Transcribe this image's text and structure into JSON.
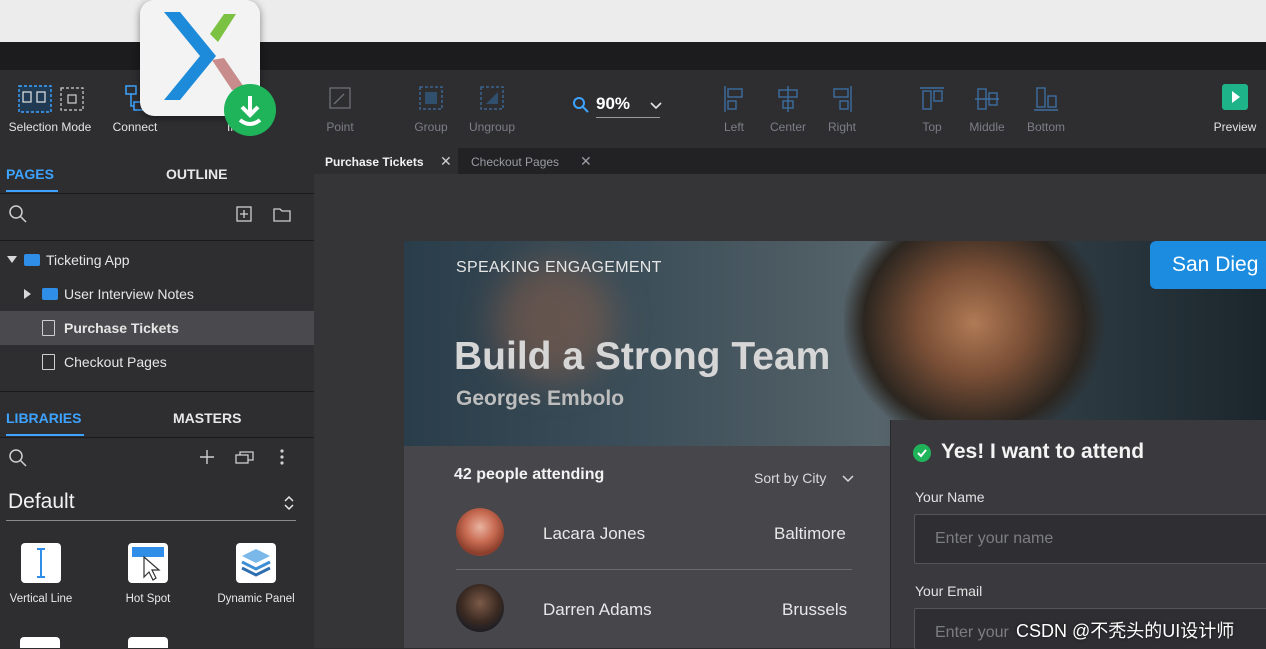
{
  "toolbar": {
    "selection_mode": "Selection Mode",
    "connect": "Connect",
    "insert_partial": "In",
    "point": "Point",
    "group": "Group",
    "ungroup": "Ungroup",
    "zoom": "90%",
    "left": "Left",
    "center": "Center",
    "right": "Right",
    "top": "Top",
    "middle": "Middle",
    "bottom": "Bottom",
    "preview": "Preview"
  },
  "panels": {
    "pages_tab": "PAGES",
    "outline_tab": "OUTLINE",
    "libraries_tab": "LIBRARIES",
    "masters_tab": "MASTERS"
  },
  "tree": {
    "root": "Ticketing App",
    "items": [
      {
        "label": "User Interview Notes"
      },
      {
        "label": "Purchase Tickets"
      },
      {
        "label": "Checkout Pages"
      }
    ]
  },
  "library": {
    "selected": "Default",
    "widgets": [
      {
        "label": "Vertical Line"
      },
      {
        "label": "Hot Spot"
      },
      {
        "label": "Dynamic Panel"
      }
    ]
  },
  "doc_tabs": [
    {
      "label": "Purchase Tickets"
    },
    {
      "label": "Checkout Pages"
    }
  ],
  "design": {
    "eyebrow": "SPEAKING ENGAGEMENT",
    "title": "Build a Strong Team",
    "speaker": "Georges Embolo",
    "city": "San Dieg",
    "attending": "42 people attending",
    "sort": "Sort by City",
    "attendees": [
      {
        "name": "Lacara Jones",
        "city": "Baltimore"
      },
      {
        "name": "Darren Adams",
        "city": "Brussels"
      }
    ],
    "rsvp_title": "Yes! I want to attend",
    "name_label": "Your Name",
    "name_placeholder": "Enter your name",
    "email_label": "Your Email",
    "email_placeholder": "Enter your"
  },
  "watermark": "CSDN @不秃头的UI设计师",
  "colors": {
    "accent": "#3ea3ff",
    "brand_blue": "#1c8ce0",
    "success": "#1fb35a"
  }
}
